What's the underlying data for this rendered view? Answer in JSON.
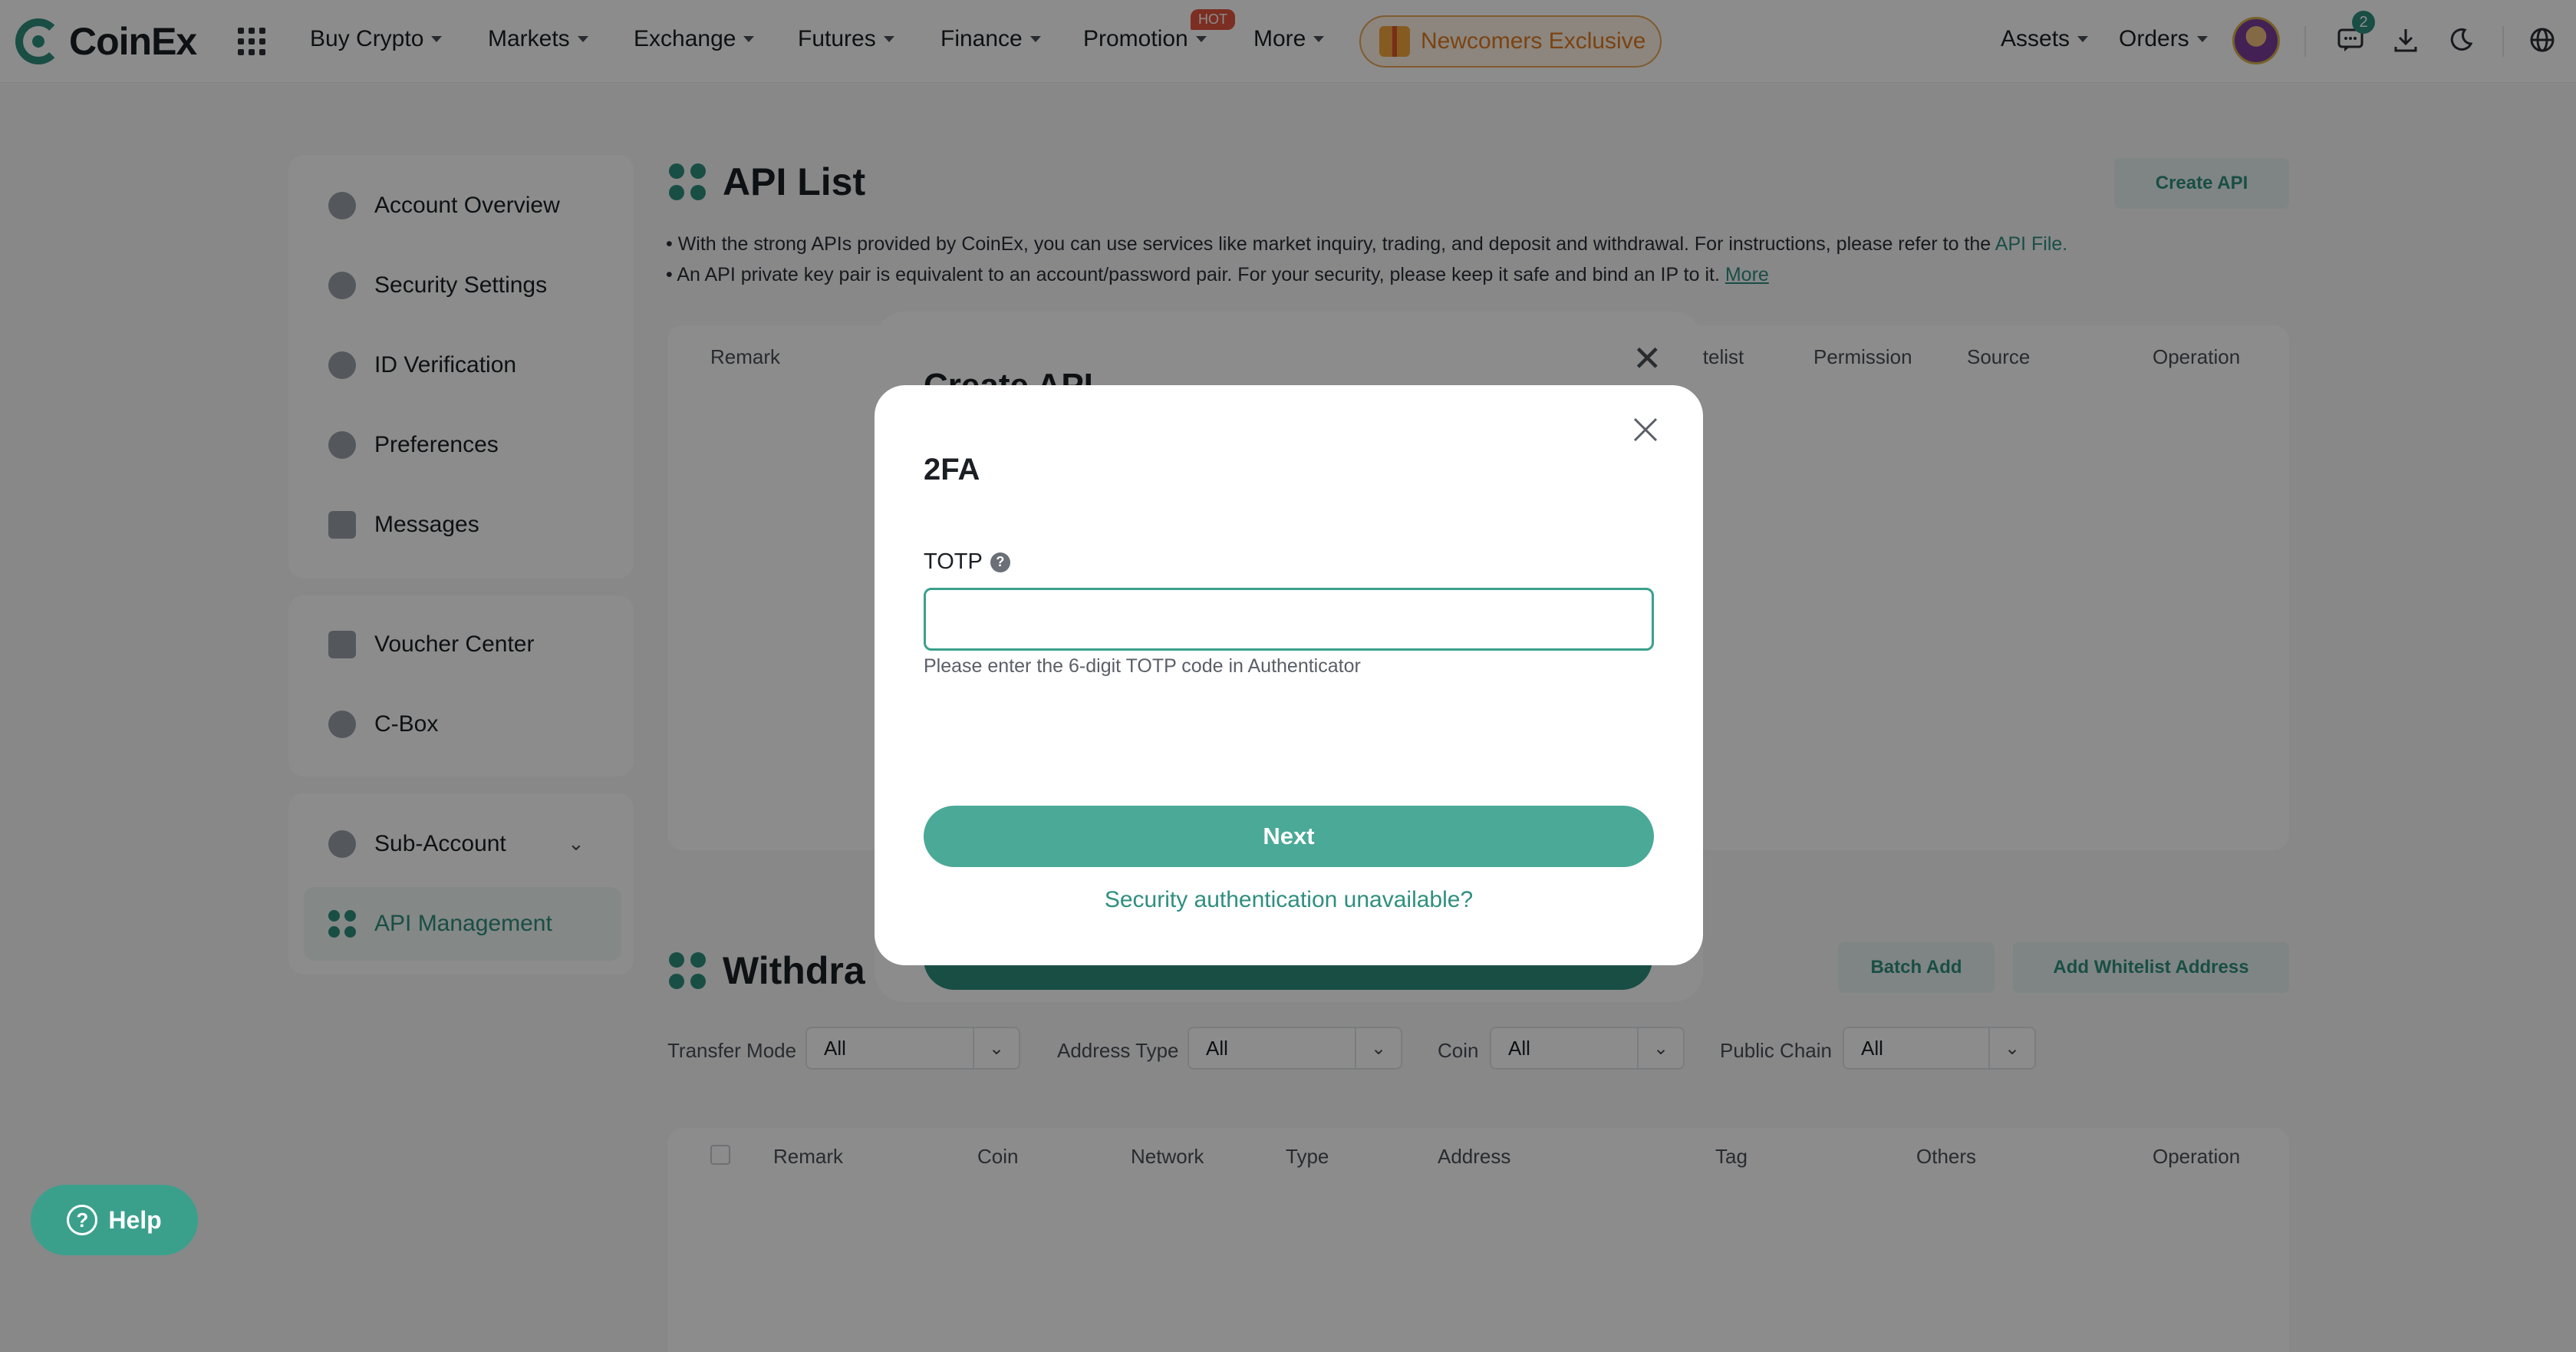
{
  "brand": {
    "name": "CoinEx",
    "accent": "#2f8f7f"
  },
  "nav": {
    "items": [
      "Buy Crypto",
      "Markets",
      "Exchange",
      "Futures",
      "Finance",
      "Promotion",
      "More"
    ],
    "hot_badge": "HOT",
    "newcomers": "Newcomers Exclusive",
    "right": {
      "assets": "Assets",
      "orders": "Orders",
      "message_count": "2"
    }
  },
  "sidebar": {
    "group1": [
      "Account Overview",
      "Security Settings",
      "ID Verification",
      "Preferences",
      "Messages"
    ],
    "group2": [
      "Voucher Center",
      "C-Box"
    ],
    "group3": [
      "Sub-Account",
      "API Management"
    ],
    "active": "API Management"
  },
  "api_list": {
    "title": "API List",
    "create_button": "Create API",
    "bullet1": "With the strong APIs provided by CoinEx, you can use services like market inquiry, trading, and deposit and withdrawal. For instructions, please refer to the",
    "bullet1_link": "API File.",
    "bullet2": "An API private key pair is equivalent to an account/password pair. For your security, please keep it safe and bind an IP to it.",
    "bullet2_link": "More",
    "columns": [
      "Remark",
      "itelist",
      "Permission",
      "Source",
      "Operation"
    ]
  },
  "withdraw": {
    "title": "Withdra",
    "batch_add": "Batch Add",
    "add_whitelist": "Add Whitelist Address",
    "filters": [
      {
        "label": "Transfer Mode",
        "value": "All"
      },
      {
        "label": "Address Type",
        "value": "All"
      },
      {
        "label": "Coin",
        "value": "All"
      },
      {
        "label": "Public Chain",
        "value": "All"
      }
    ],
    "columns": [
      "Remark",
      "Coin",
      "Network",
      "Type",
      "Address",
      "Tag",
      "Others",
      "Operation"
    ]
  },
  "bg_modal": {
    "title": "Create API"
  },
  "modal": {
    "title": "2FA",
    "totp_label": "TOTP",
    "totp_value": "",
    "hint": "Please enter the 6-digit TOTP code in Authenticator",
    "next": "Next",
    "unavailable_link": "Security authentication unavailable?"
  },
  "help": {
    "label": "Help"
  },
  "icons": {
    "close": "close-icon",
    "help": "question-icon",
    "apps": "apps-grid-icon",
    "messages": "chat-icon",
    "download": "download-icon",
    "theme": "moon-icon",
    "language": "globe-icon"
  }
}
